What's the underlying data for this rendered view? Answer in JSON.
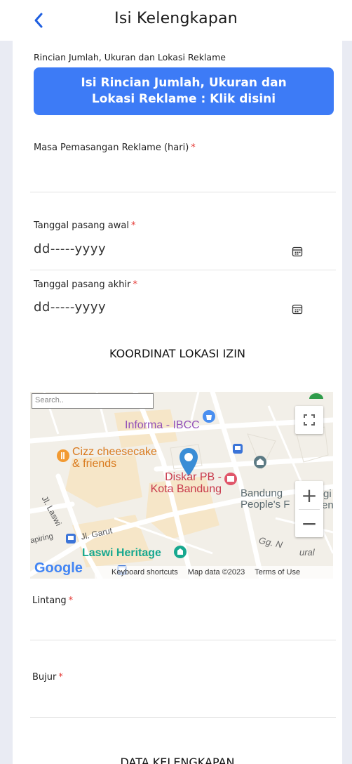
{
  "header": {
    "title": "Isi Kelengkapan",
    "back_icon": "chevron-left-icon"
  },
  "rincian": {
    "label": "Rincian Jumlah, Ukuran dan Lokasi Reklame",
    "button_line1": "Isi Rincian Jumlah, Ukuran dan",
    "button_line2": "Lokasi Reklame : Klik disini",
    "button_color": "#3d7bf6"
  },
  "masa": {
    "label": "Masa Pemasangan Reklame (hari)",
    "required": "*",
    "value": ""
  },
  "tanggal_awal": {
    "label": "Tanggal pasang awal",
    "required": "*",
    "placeholder": "dd-----yyyy"
  },
  "tanggal_akhir": {
    "label": "Tanggal pasang akhir",
    "required": "*",
    "placeholder": "dd-----yyyy"
  },
  "koordinat": {
    "title": "KOORDINAT LOKASI IZIN"
  },
  "map": {
    "search_placeholder": "Search..",
    "places": {
      "informa": "Informa - IBCC",
      "cizz_line1": "Cizz cheesecake",
      "cizz_line2": "& friends",
      "diskar_line1": "Diskar PB -",
      "diskar_line2": "Kota Bandung",
      "bandung_line1": "Bandung",
      "bandung_line2": "People's F",
      "laswi": "Laswi Heritage",
      "jl_laswi": "Jl. Laswi",
      "jl_garut": "Jl. Garut",
      "gg": "Gg. N",
      "apiring": "apiring",
      "gi": "gi",
      "en": "en",
      "ural": "ural"
    },
    "logo": "Google",
    "attribution": [
      "Keyboard shortcuts",
      "Map data ©2023",
      "Terms of Use"
    ],
    "zoom_in": "+",
    "zoom_out": "−"
  },
  "lintang": {
    "label": "Lintang",
    "required": "*",
    "value": ""
  },
  "bujur": {
    "label": "Bujur",
    "required": "*",
    "value": ""
  },
  "data_kelengkapan": {
    "title": "DATA KELENGKAPAN"
  }
}
